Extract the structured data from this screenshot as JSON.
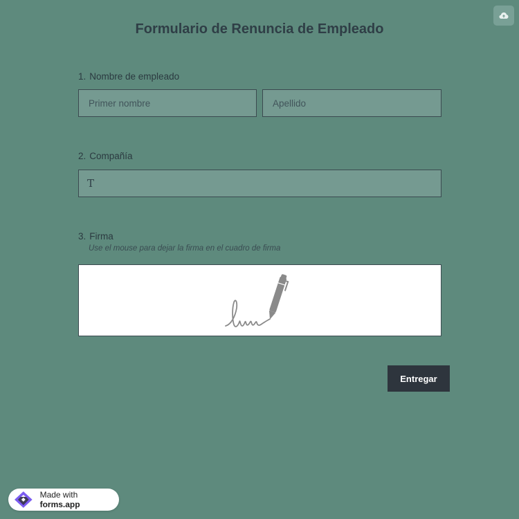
{
  "header": {
    "title": "Formulario de Renuncia de Empleado",
    "upload_icon": "cloud-upload-icon"
  },
  "questions": [
    {
      "number": "1.",
      "label": "Nombre de empleado",
      "fields": [
        {
          "placeholder": "Primer nombre",
          "value": ""
        },
        {
          "placeholder": "Apellido",
          "value": ""
        }
      ]
    },
    {
      "number": "2.",
      "label": "Compañía",
      "fields": [
        {
          "placeholder": "",
          "value": "T"
        }
      ]
    },
    {
      "number": "3.",
      "label": "Firma",
      "hint": "Use el mouse para dejar la firma en el cuadro de firma",
      "icon": "signature-pen-icon"
    }
  ],
  "actions": {
    "submit_label": "Entregar"
  },
  "badge": {
    "prefix": "Made with ",
    "brand": "forms.app",
    "logo_icon": "forms-app-logo-icon"
  },
  "colors": {
    "background": "#5e8a7d",
    "field_bg": "#759a91",
    "button_bg": "#2e353d",
    "logo_purple": "#7b5cf0"
  }
}
